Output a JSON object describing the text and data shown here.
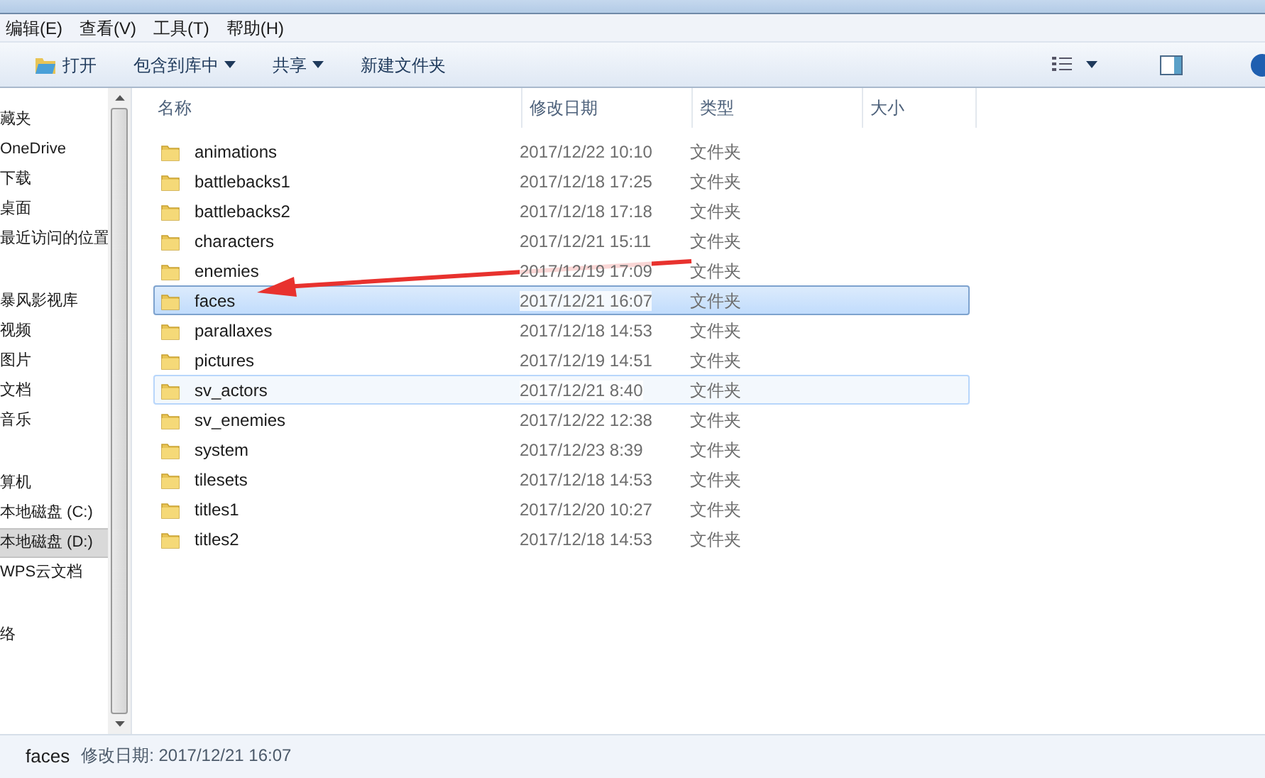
{
  "menu": [
    "编辑(E)",
    "查看(V)",
    "工具(T)",
    "帮助(H)"
  ],
  "toolbar": [
    {
      "label": "打开",
      "kind": "icon"
    },
    {
      "label": "包含到库中",
      "kind": "dropdown"
    },
    {
      "label": "共享",
      "kind": "dropdown"
    },
    {
      "label": "新建文件夹",
      "kind": "plain"
    }
  ],
  "sidebar": {
    "groups": [
      [
        {
          "label": "藏夹",
          "selected": false
        },
        {
          "label": "OneDrive",
          "selected": false
        },
        {
          "label": "下载",
          "selected": false
        },
        {
          "label": "桌面",
          "selected": false
        },
        {
          "label": "最近访问的位置",
          "selected": false
        }
      ],
      [
        {
          "label": "暴风影视库",
          "selected": false
        },
        {
          "label": "视频",
          "selected": false
        },
        {
          "label": "图片",
          "selected": false
        },
        {
          "label": "文档",
          "selected": false
        },
        {
          "label": "音乐",
          "selected": false
        }
      ],
      [
        {
          "label": "算机",
          "selected": false
        },
        {
          "label": "本地磁盘 (C:)",
          "selected": false
        },
        {
          "label": "本地磁盘 (D:)",
          "selected": true
        },
        {
          "label": "WPS云文档",
          "selected": false
        }
      ],
      [
        {
          "label": "络",
          "selected": false
        }
      ]
    ]
  },
  "table": {
    "columns": [
      "名称",
      "修改日期",
      "类型",
      "大小"
    ],
    "rows": [
      {
        "name": "animations",
        "date": "2017/12/22 10:10",
        "type": "文件夹",
        "selected": false,
        "hovered": false
      },
      {
        "name": "battlebacks1",
        "date": "2017/12/18 17:25",
        "type": "文件夹",
        "selected": false,
        "hovered": false
      },
      {
        "name": "battlebacks2",
        "date": "2017/12/18 17:18",
        "type": "文件夹",
        "selected": false,
        "hovered": false
      },
      {
        "name": "characters",
        "date": "2017/12/21 15:11",
        "type": "文件夹",
        "selected": false,
        "hovered": false
      },
      {
        "name": "enemies",
        "date": "2017/12/19 17:09",
        "type": "文件夹",
        "selected": false,
        "hovered": false
      },
      {
        "name": "faces",
        "date": "2017/12/21 16:07",
        "type": "文件夹",
        "selected": true,
        "hovered": false
      },
      {
        "name": "parallaxes",
        "date": "2017/12/18 14:53",
        "type": "文件夹",
        "selected": false,
        "hovered": false
      },
      {
        "name": "pictures",
        "date": "2017/12/19 14:51",
        "type": "文件夹",
        "selected": false,
        "hovered": false
      },
      {
        "name": "sv_actors",
        "date": "2017/12/21 8:40",
        "type": "文件夹",
        "selected": false,
        "hovered": true
      },
      {
        "name": "sv_enemies",
        "date": "2017/12/22 12:38",
        "type": "文件夹",
        "selected": false,
        "hovered": false
      },
      {
        "name": "system",
        "date": "2017/12/23 8:39",
        "type": "文件夹",
        "selected": false,
        "hovered": false
      },
      {
        "name": "tilesets",
        "date": "2017/12/18 14:53",
        "type": "文件夹",
        "selected": false,
        "hovered": false
      },
      {
        "name": "titles1",
        "date": "2017/12/20 10:27",
        "type": "文件夹",
        "selected": false,
        "hovered": false
      },
      {
        "name": "titles2",
        "date": "2017/12/18 14:53",
        "type": "文件夹",
        "selected": false,
        "hovered": false
      }
    ]
  },
  "status_bar": {
    "name": "faces",
    "detail": "修改日期: 2017/12/21 16:07"
  }
}
